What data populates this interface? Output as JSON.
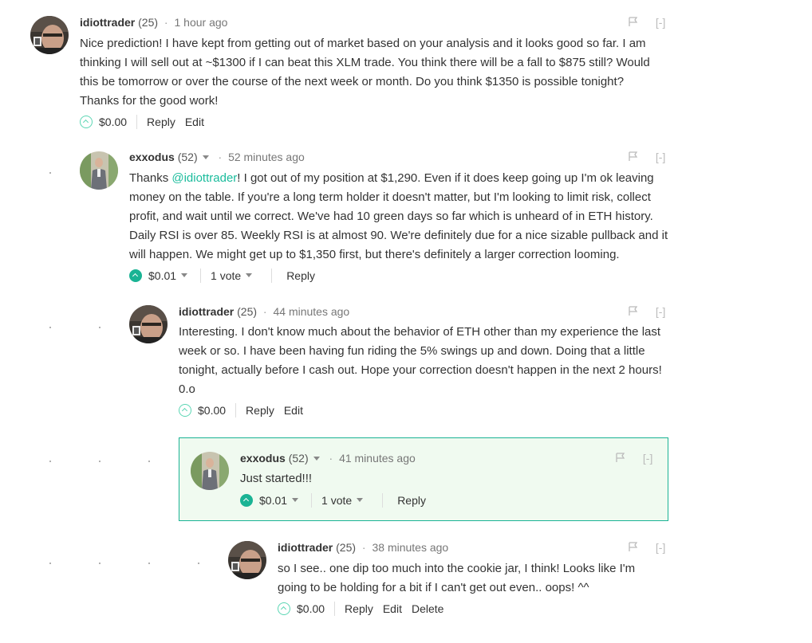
{
  "comments": [
    {
      "author": "idiottrader",
      "rep": "(25)",
      "time": "1 hour ago",
      "body": "Nice prediction! I have kept from getting out of market based on your analysis and it looks good so far. I am thinking I will sell out at ~$1300 if I can beat this XLM trade. You think there will be a fall to $875 still? Would this be tomorrow or over the course of the next week or month. Do you think $1350 is possible tonight? Thanks for the good work!",
      "payout": "$0.00",
      "reply": "Reply",
      "edit": "Edit",
      "flag_collapse": "[-]"
    },
    {
      "author": "exxodus",
      "rep": "(52)",
      "time": "52 minutes ago",
      "body_prefix": "Thanks ",
      "mention": "@idiottrader",
      "body_suffix": "! I got out of my position at $1,290. Even if it does keep going up I'm ok leaving money on the table. If you're a long term holder it doesn't matter, but I'm looking to limit risk, collect profit, and wait until we correct. We've had 10 green days so far which is unheard of in ETH history. Daily RSI is over 85. Weekly RSI is at almost 90. We're definitely due for a nice sizable pullback and it will happen. We might get up to $1,350 first, but there's definitely a larger correction looming.",
      "payout": "$0.01",
      "votes": "1 vote",
      "reply": "Reply",
      "flag_collapse": "[-]"
    },
    {
      "author": "idiottrader",
      "rep": "(25)",
      "time": "44 minutes ago",
      "body": "Interesting. I don't know much about the behavior of ETH other than my experience the last week or so. I have been having fun riding the 5% swings up and down. Doing that a little tonight, actually before I cash out. Hope your correction doesn't happen in the next 2 hours! 0.o",
      "payout": "$0.00",
      "reply": "Reply",
      "edit": "Edit",
      "flag_collapse": "[-]"
    },
    {
      "author": "exxodus",
      "rep": "(52)",
      "time": "41 minutes ago",
      "body": "Just started!!!",
      "payout": "$0.01",
      "votes": "1 vote",
      "reply": "Reply",
      "flag_collapse": "[-]"
    },
    {
      "author": "idiottrader",
      "rep": "(25)",
      "time": "38 minutes ago",
      "body": "so I see.. one dip too much into the cookie jar, I think! Looks like I'm going to be holding for a bit if I can't get out even.. oops! ^^",
      "payout": "$0.00",
      "reply": "Reply",
      "edit": "Edit",
      "delete": "Delete",
      "flag_collapse": "[-]"
    }
  ],
  "colors": {
    "accent": "#1ab394",
    "mention": "#1abc9c",
    "highlight_bg": "#f0faf0"
  }
}
